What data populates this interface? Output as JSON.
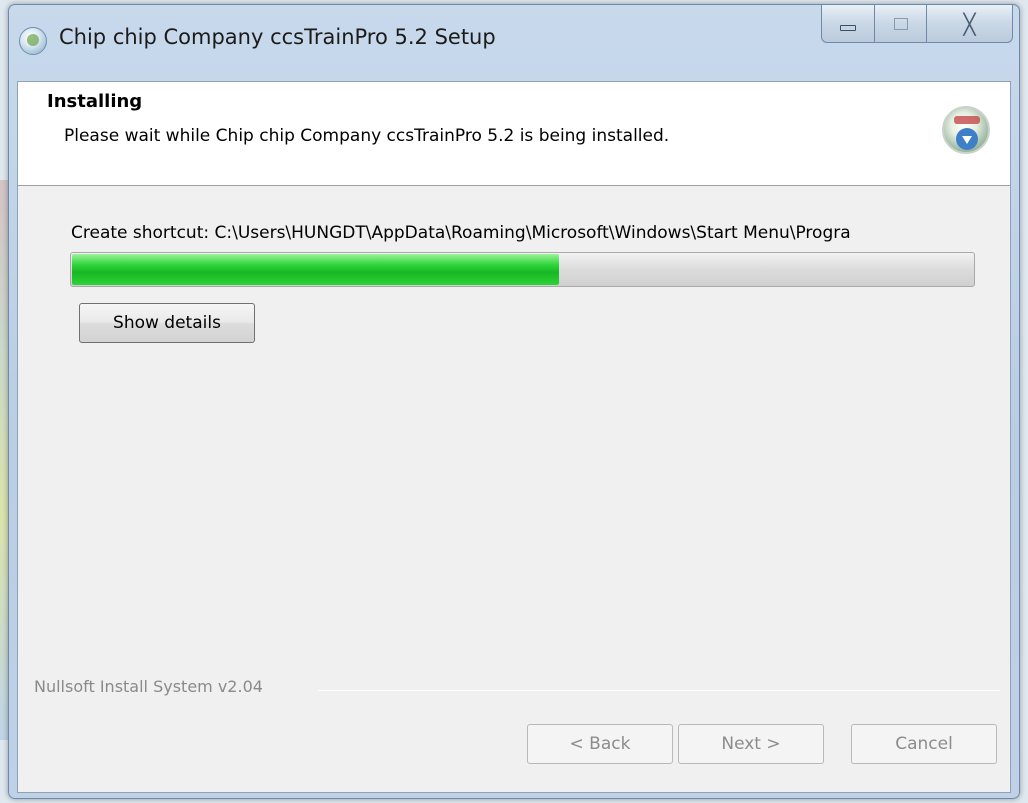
{
  "window": {
    "title": "Chip chip Company ccsTrainPro 5.2 Setup",
    "caption_buttons": {
      "minimize_icon": "minimize-icon",
      "maximize_icon": "maximize-icon",
      "close_glyph": "╳"
    }
  },
  "header": {
    "title": "Installing",
    "subtitle": "Please wait while Chip chip Company ccsTrainPro 5.2 is being installed.",
    "icon": "installer-icon"
  },
  "progress": {
    "status": "Create shortcut: C:\\Users\\HUNGDT\\AppData\\Roaming\\Microsoft\\Windows\\Start Menu\\Progra",
    "fraction": 0.54,
    "fill_color": "#1fbf2a"
  },
  "buttons": {
    "details": "Show details",
    "back": "< Back",
    "next": "Next >",
    "cancel": "Cancel"
  },
  "footer": {
    "branding": "Nullsoft Install System v2.04"
  }
}
